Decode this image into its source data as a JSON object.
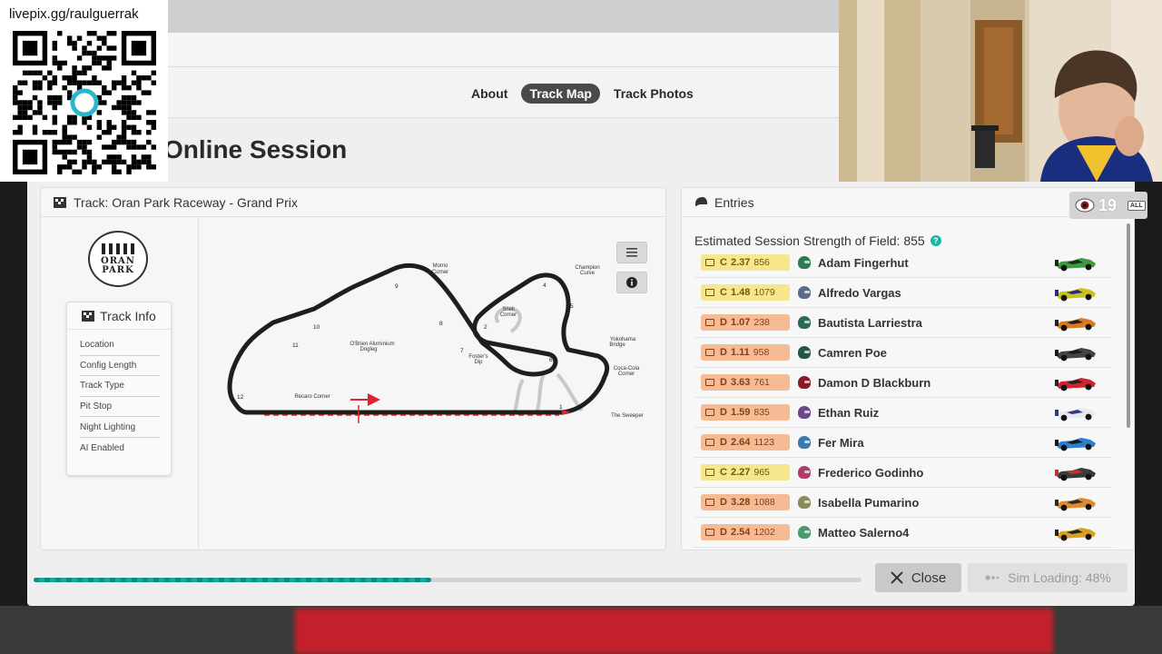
{
  "overlay": {
    "stream_url": "livepix.gg/raulguerrak",
    "viewer_count": "19",
    "viewer_filter": "ALL"
  },
  "tabs": [
    {
      "label": "About",
      "active": false
    },
    {
      "label": "Track Map",
      "active": true
    },
    {
      "label": "Track Photos",
      "active": false
    }
  ],
  "session_title": "Online Session",
  "track": {
    "title": "Track: Oran Park Raceway - Grand Prix",
    "logo_line1": "ORAN",
    "logo_line2": "PARK",
    "info_heading": "Track Info",
    "info_items": [
      "Location",
      "Config Length",
      "Track Type",
      "Pit Stop",
      "Night Lighting",
      "AI Enabled"
    ],
    "turn_labels": [
      "1",
      "2",
      "4",
      "5",
      "6",
      "7",
      "8",
      "9",
      "10",
      "11",
      "12"
    ],
    "corner_names": {
      "momo": [
        "Momo",
        "Corner"
      ],
      "champion": [
        "Champion",
        "Curve"
      ],
      "shell": [
        "Shell",
        "Corner"
      ],
      "obrien": [
        "O'Brien Aluminium",
        "Dogleg"
      ],
      "fosters": [
        "Foster's",
        "Dip"
      ],
      "yokohama": [
        "Yokohama",
        "Bridge"
      ],
      "cocacola": [
        "Coca-Cola",
        "Corner"
      ],
      "recaro": "Recaro Corner",
      "sweeper": "The Sweeper"
    }
  },
  "entries": {
    "title": "Entries",
    "sof_label": "Estimated Session Strength of Field: 855",
    "help": "?",
    "rows": [
      {
        "class": "C",
        "sr": "2.37",
        "ir": "856",
        "name": "Adam Fingerhut",
        "helmet": "#2f7a55",
        "car": "#3f9a3f",
        "car2": "#1d2b1d"
      },
      {
        "class": "C",
        "sr": "1.48",
        "ir": "1079",
        "name": "Alfredo Vargas",
        "helmet": "#5a6b8c",
        "car": "#c8c21a",
        "car2": "#2a2a8a"
      },
      {
        "class": "D",
        "sr": "1.07",
        "ir": "238",
        "name": "Bautista Larriestra",
        "helmet": "#2c6a52",
        "car": "#d87a20",
        "car2": "#222222"
      },
      {
        "class": "D",
        "sr": "1.11",
        "ir": "958",
        "name": "Camren Poe",
        "helmet": "#24564a",
        "car": "#444444",
        "car2": "#1a1a1a"
      },
      {
        "class": "D",
        "sr": "3.63",
        "ir": "761",
        "name": "Damon D Blackburn",
        "helmet": "#8a1a2a",
        "car": "#d0232f",
        "car2": "#222222"
      },
      {
        "class": "D",
        "sr": "1.59",
        "ir": "835",
        "name": "Ethan Ruiz",
        "helmet": "#6a4a8a",
        "car": "#e8e8ee",
        "car2": "#2a3a8a"
      },
      {
        "class": "D",
        "sr": "2.64",
        "ir": "1123",
        "name": "Fer Mira",
        "helmet": "#3a7ab0",
        "car": "#2a7fd0",
        "car2": "#1a1a1a"
      },
      {
        "class": "C",
        "sr": "2.27",
        "ir": "965",
        "name": "Frederico Godinho",
        "helmet": "#b03a6a",
        "car": "#3a3a3a",
        "car2": "#c83030"
      },
      {
        "class": "D",
        "sr": "3.28",
        "ir": "1088",
        "name": "Isabella Pumarino",
        "helmet": "#8a8a5a",
        "car": "#e08a30",
        "car2": "#2a2a2a"
      },
      {
        "class": "D",
        "sr": "2.54",
        "ir": "1202",
        "name": "Matteo Salerno4",
        "helmet": "#4a9a6a",
        "car": "#d8a020",
        "car2": "#222222"
      }
    ]
  },
  "footer": {
    "progress_percent": 48,
    "close_label": "Close",
    "sim_loading_label": "Sim Loading: 48%"
  },
  "colors": {
    "accent": "#16a89a",
    "active_tab": "#4a4a4a",
    "license_c": "#f6e68c",
    "license_d": "#f5bb95",
    "start_arrow": "#e0242c"
  }
}
